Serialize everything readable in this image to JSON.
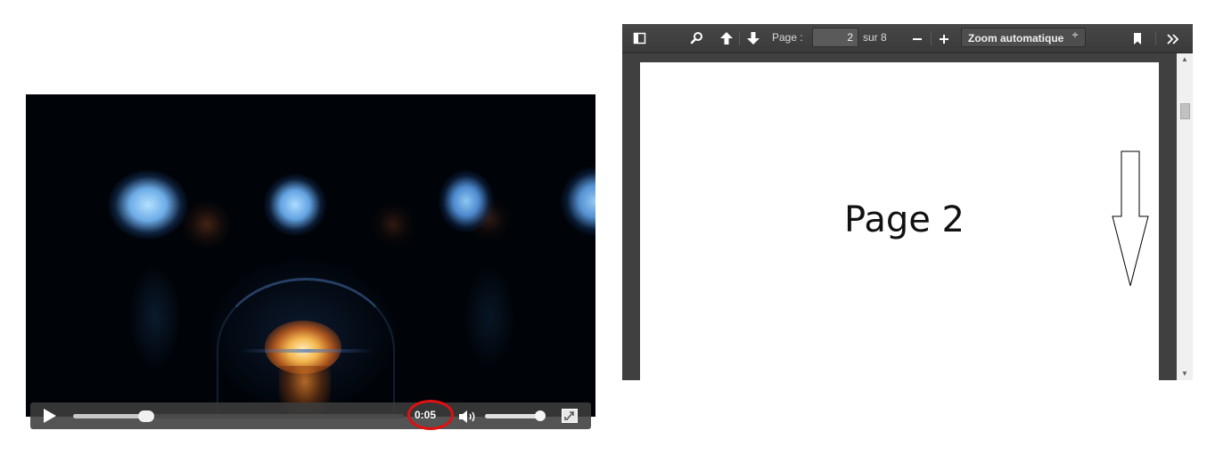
{
  "video_player": {
    "time": "0:05",
    "progress_fraction": 0.22,
    "volume_fraction": 0.95,
    "highlight_color": "#e01010"
  },
  "pdf_viewer": {
    "toolbar": {
      "page_label": "Page :",
      "page_value": "2",
      "page_count": "sur 8",
      "zoom_value": "Zoom automatique",
      "zoom_arrow": "÷",
      "icons": [
        "sidebar-toggle-icon",
        "search-icon",
        "previous-page-icon",
        "next-page-icon",
        "zoom-out-icon",
        "zoom-in-icon",
        "bookmark-icon",
        "tools-icon"
      ]
    },
    "page": {
      "heading": "Page 2"
    }
  }
}
